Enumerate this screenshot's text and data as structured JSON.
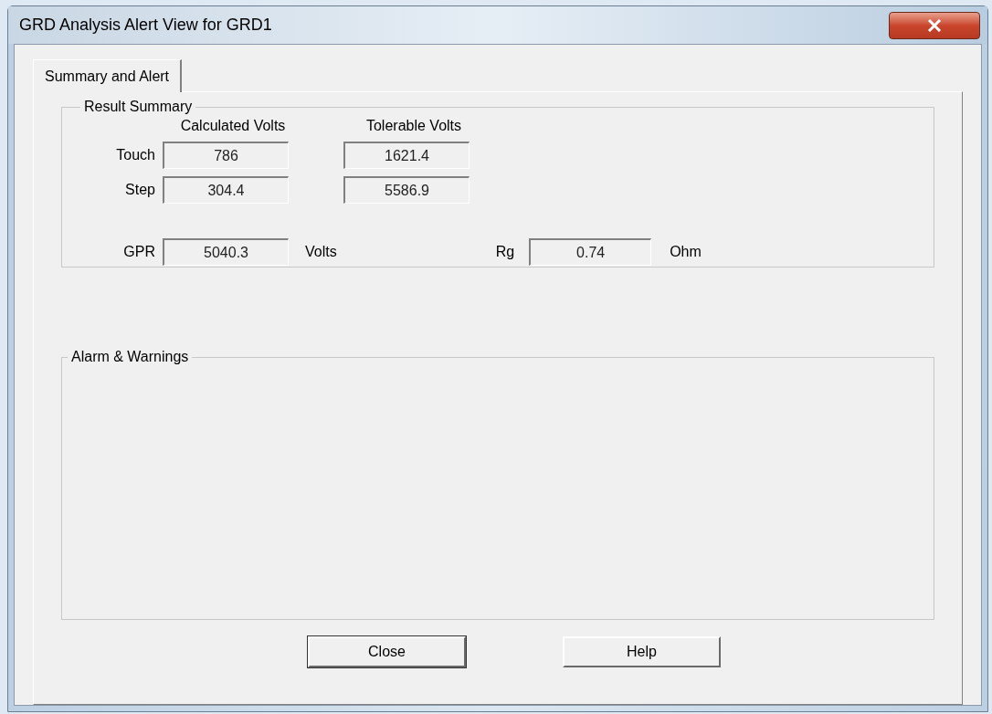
{
  "window": {
    "title": "GRD Analysis Alert View for GRD1"
  },
  "tabs": [
    {
      "label": "Summary and Alert",
      "selected": true
    }
  ],
  "result_summary": {
    "title": "Result Summary",
    "columns": [
      "Calculated Volts",
      "Tolerable Volts"
    ],
    "rows": [
      {
        "label": "Touch",
        "calculated": "786",
        "tolerable": "1621.4"
      },
      {
        "label": "Step",
        "calculated": "304.4",
        "tolerable": "5586.9"
      }
    ],
    "gpr": {
      "label": "GPR",
      "value": "5040.3",
      "unit": "Volts"
    },
    "rg": {
      "label": "Rg",
      "value": "0.74",
      "unit": "Ohm"
    }
  },
  "alarms": {
    "title": "Alarm & Warnings"
  },
  "buttons": [
    "Close",
    "Help"
  ]
}
